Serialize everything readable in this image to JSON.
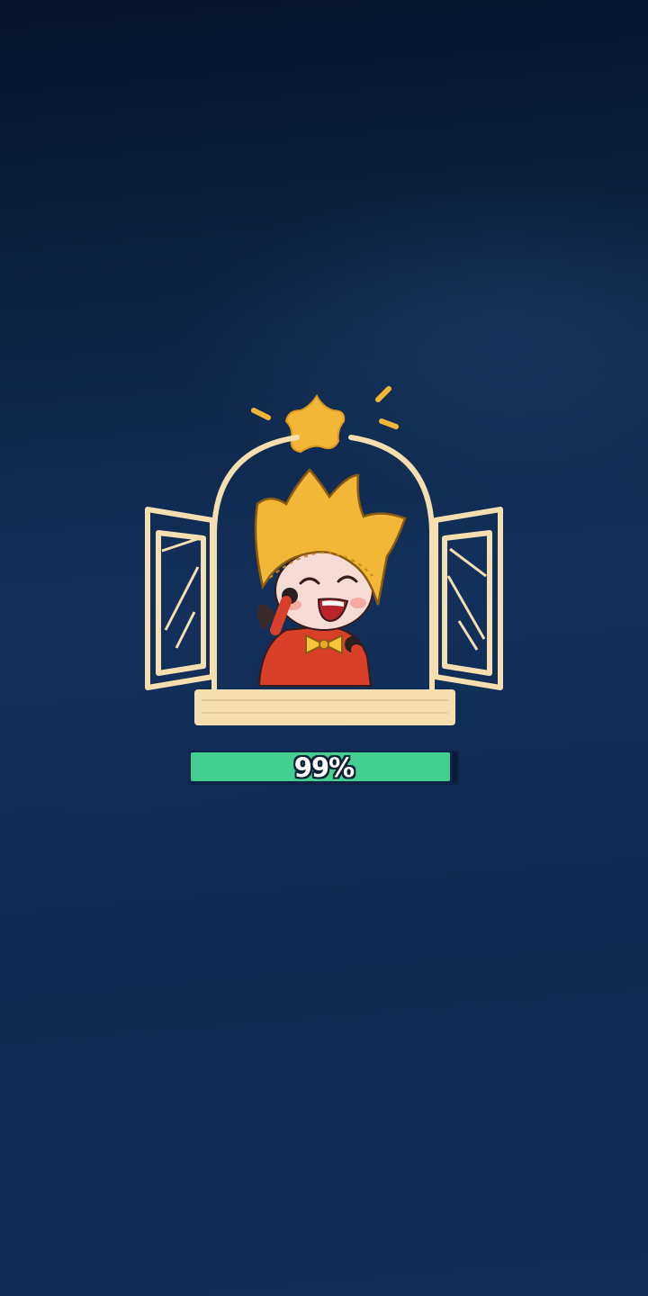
{
  "loading": {
    "progress_percent": 99,
    "progress_label": "99%"
  },
  "colors": {
    "background_top": "#07142b",
    "background_bottom": "#112d55",
    "window_line": "#f5dfb0",
    "progress_fill": "#43cf8f",
    "crown_hat": "#f2b736",
    "outfit": "#d8402a",
    "bow": "#f5c43a",
    "skin": "#f7dcd6"
  },
  "icons": {
    "splash_illustration": "window-crown-kid-illustration",
    "star": "star-icon"
  }
}
